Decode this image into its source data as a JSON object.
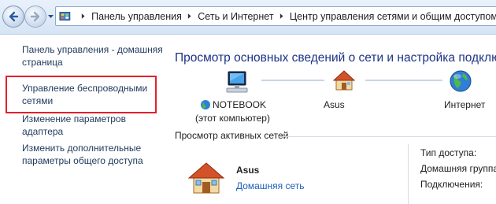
{
  "address_bar": {
    "icon": "control-panel-icon",
    "breadcrumbs": [
      "Панель управления",
      "Сеть и Интернет",
      "Центр управления сетями и общим доступом"
    ]
  },
  "sidebar": {
    "items": [
      {
        "label": "Панель управления - домашняя страница"
      },
      {
        "label": "Управление беспроводными сетями"
      },
      {
        "label": "Изменение параметров адаптера"
      },
      {
        "label": "Изменить дополнительные параметры общего доступа"
      }
    ],
    "highlight_color": "#e3202a"
  },
  "main": {
    "heading": "Просмотр основных сведений о сети и настройка подклю",
    "map": {
      "computer": {
        "name": "NOTEBOOK",
        "subtitle": "(этот компьютер)",
        "icon": "computer-icon"
      },
      "network": {
        "name": "Asus",
        "icon": "home-network-icon"
      },
      "internet": {
        "name": "Интернет",
        "icon": "globe-icon"
      }
    },
    "active_networks_title": "Просмотр активных сетей",
    "active_network": {
      "name": "Asus",
      "type": "Домашняя сеть",
      "icon": "home-network-icon"
    },
    "properties": [
      "Тип доступа:",
      "Домашняя группа:",
      "Подключения:"
    ]
  },
  "colors": {
    "heading": "#1e3287",
    "link": "#1e395b",
    "network_type_link": "#1e5dbd"
  }
}
